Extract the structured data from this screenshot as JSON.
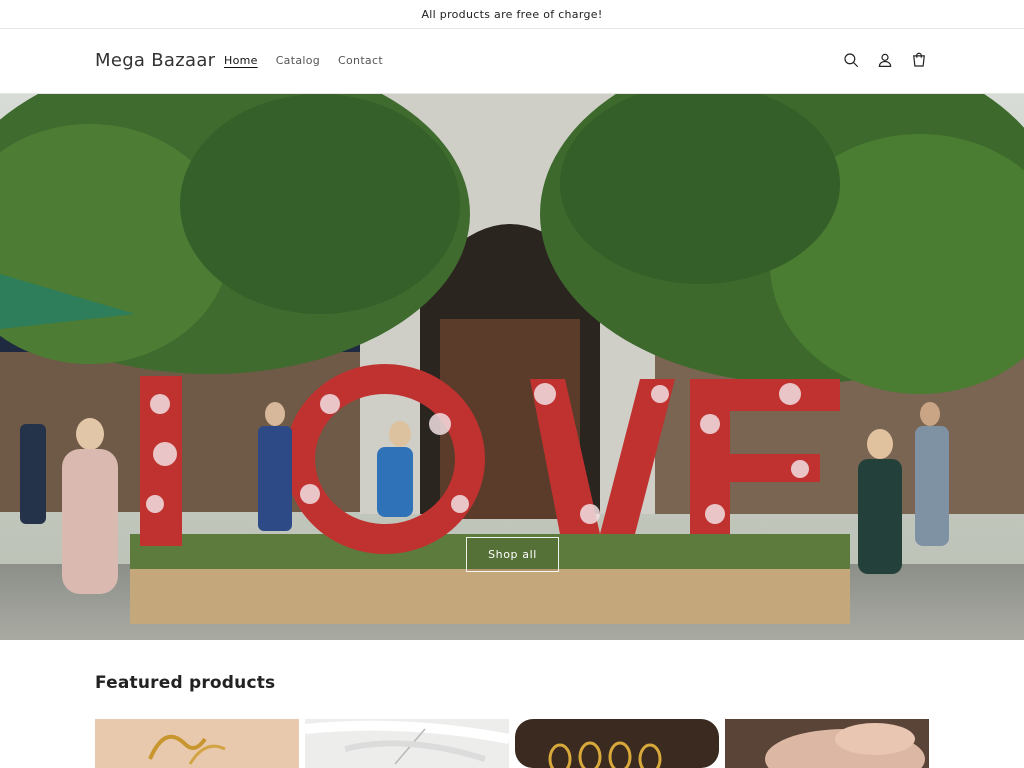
{
  "announcement": {
    "text": "All products are free of charge!"
  },
  "header": {
    "logo": "Mega Bazaar",
    "nav": [
      {
        "label": "Home",
        "active": true
      },
      {
        "label": "Catalog",
        "active": false
      },
      {
        "label": "Contact",
        "active": false
      }
    ],
    "icons": [
      "search-icon",
      "account-icon",
      "cart-icon"
    ]
  },
  "hero": {
    "button_label": "Shop all"
  },
  "featured": {
    "title": "Featured products",
    "products": [
      {
        "image": "gold-bracelet-image"
      },
      {
        "image": "silver-necklace-image"
      },
      {
        "image": "stacked-rings-image"
      },
      {
        "image": "ring-on-hand-image"
      }
    ]
  },
  "colors": {
    "text": "#121212",
    "border": "#e6e6e6",
    "background": "#ffffff"
  }
}
